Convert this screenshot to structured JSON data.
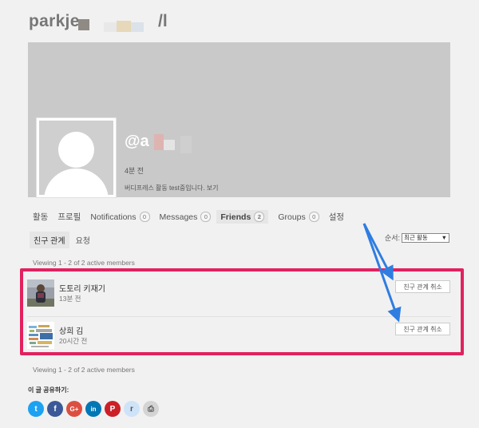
{
  "profile": {
    "name_visible": "parkje",
    "name_trailing": "/l",
    "handle": "@a",
    "last_active": "4분 전",
    "status_text": "버디프레스 활동 test중입니다. 보기"
  },
  "nav": {
    "tabs": [
      {
        "label": "활동"
      },
      {
        "label": "프로필"
      },
      {
        "label": "Notifications",
        "count": "0"
      },
      {
        "label": "Messages",
        "count": "0"
      },
      {
        "label": "Friends",
        "count": "2"
      },
      {
        "label": "Groups",
        "count": "0"
      },
      {
        "label": "설정"
      }
    ]
  },
  "subnav": {
    "items": [
      {
        "label": "친구 관계"
      },
      {
        "label": "요청"
      }
    ],
    "order_label": "순서:",
    "order_value": "최근 활동"
  },
  "viewing_top": "Viewing 1 - 2 of 2 active members",
  "viewing_bottom": "Viewing 1 - 2 of 2 active members",
  "members": [
    {
      "name": "도토리 키재기",
      "time": "13분 전",
      "button": "친구 관계 취소"
    },
    {
      "name": "상희 김",
      "time": "20시간 전",
      "button": "친구 관계 취소"
    }
  ],
  "share": {
    "label": "이 글 공유하기:",
    "buttons": [
      {
        "icon": "twitter-icon",
        "glyph": "t",
        "color": "#1da1f2"
      },
      {
        "icon": "facebook-icon",
        "glyph": "f",
        "color": "#3b5998"
      },
      {
        "icon": "google-plus-icon",
        "glyph": "G+",
        "color": "#dc4e41"
      },
      {
        "icon": "linkedin-icon",
        "glyph": "in",
        "color": "#0077b5"
      },
      {
        "icon": "pinterest-icon",
        "glyph": "P",
        "color": "#cb2027"
      },
      {
        "icon": "reddit-icon",
        "glyph": "r",
        "color": "#cee3f8"
      },
      {
        "icon": "print-icon",
        "glyph": "⎙",
        "color": "#d4d4d4"
      }
    ]
  },
  "colors": {
    "highlight_border": "#e2215f",
    "annotation_arrow": "#2f7de1"
  }
}
